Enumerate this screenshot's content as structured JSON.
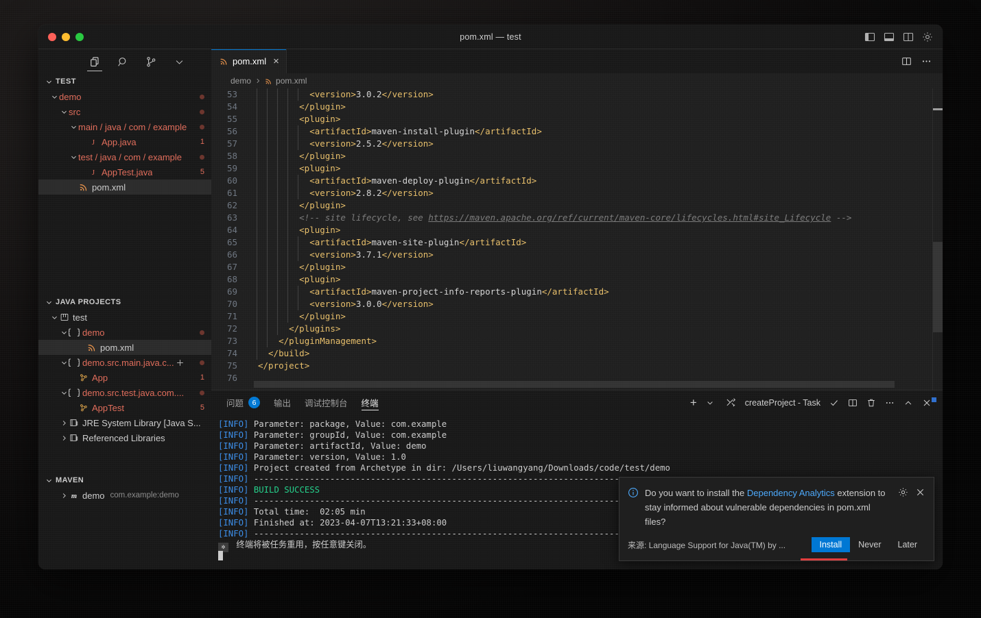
{
  "window": {
    "title": "pom.xml — test",
    "traffic_lights": [
      "close",
      "minimize",
      "zoom"
    ],
    "layout_icons": [
      "toggle-primary-sidebar",
      "toggle-panel",
      "toggle-secondary-sidebar",
      "customize-layout"
    ]
  },
  "activitybar": {
    "items": [
      {
        "name": "explorer",
        "icon": "files-icon",
        "active": true
      },
      {
        "name": "search",
        "icon": "search-icon",
        "active": false
      },
      {
        "name": "source-control",
        "icon": "source-control-icon",
        "active": false
      },
      {
        "name": "more",
        "icon": "chevron-down-icon",
        "active": false
      }
    ]
  },
  "sidebar": {
    "explorer": {
      "title": "TEST",
      "rows": [
        {
          "label": "demo",
          "indent": 16,
          "twisty": "down",
          "modified": true,
          "marker": "dot",
          "icon": "",
          "cls": "mod"
        },
        {
          "label": "src",
          "indent": 30,
          "twisty": "down",
          "modified": true,
          "marker": "dot",
          "icon": "",
          "cls": "mod"
        },
        {
          "label": "main / java / com / example",
          "indent": 44,
          "twisty": "down",
          "modified": true,
          "marker": "dot",
          "icon": "",
          "cls": "mod"
        },
        {
          "label": "App.java",
          "indent": 72,
          "twisty": "none",
          "marker": "count",
          "count": "1",
          "icon": "java-icon",
          "cls": "mod"
        },
        {
          "label": "test / java / com / example",
          "indent": 44,
          "twisty": "down",
          "modified": true,
          "marker": "dot",
          "icon": "",
          "cls": "mod"
        },
        {
          "label": "AppTest.java",
          "indent": 72,
          "twisty": "none",
          "marker": "count",
          "count": "5",
          "icon": "java-icon",
          "cls": "mod"
        },
        {
          "label": "pom.xml",
          "indent": 58,
          "twisty": "none",
          "marker": "none",
          "icon": "xml-icon",
          "cls": "",
          "selected": true
        }
      ]
    },
    "java_projects": {
      "title": "JAVA PROJECTS",
      "rows": [
        {
          "label": "test",
          "indent": 16,
          "twisty": "down",
          "icon": "project-icon",
          "marker": "none",
          "cls": ""
        },
        {
          "label": "demo",
          "indent": 30,
          "twisty": "down",
          "icon": "package-icon",
          "marker": "dot",
          "cls": "mod"
        },
        {
          "label": "pom.xml",
          "indent": 70,
          "twisty": "none",
          "icon": "xml-icon",
          "marker": "none",
          "cls": "",
          "selected": true
        },
        {
          "label": "demo.src.main.java.c...",
          "indent": 30,
          "twisty": "down",
          "icon": "package-icon",
          "marker": "dot",
          "cls": "mod",
          "plus": true
        },
        {
          "label": "App",
          "indent": 58,
          "twisty": "none",
          "icon": "class-icon",
          "marker": "count",
          "count": "1",
          "cls": "mod"
        },
        {
          "label": "demo.src.test.java.com....",
          "indent": 30,
          "twisty": "down",
          "icon": "package-icon",
          "marker": "dot",
          "cls": "mod"
        },
        {
          "label": "AppTest",
          "indent": 58,
          "twisty": "none",
          "icon": "class-icon",
          "marker": "count",
          "count": "5",
          "cls": "mod"
        },
        {
          "label": "JRE System Library [Java S...",
          "indent": 30,
          "twisty": "right",
          "icon": "library-icon",
          "marker": "none",
          "cls": ""
        },
        {
          "label": "Referenced Libraries",
          "indent": 30,
          "twisty": "right",
          "icon": "library-icon",
          "marker": "none",
          "cls": ""
        }
      ]
    },
    "maven": {
      "title": "MAVEN",
      "rows": [
        {
          "label": "demo",
          "sub": "com.example:demo",
          "indent": 30,
          "twisty": "right",
          "icon": "maven-icon"
        }
      ]
    }
  },
  "editor": {
    "tab": {
      "label": "pom.xml",
      "icon": "xml-icon",
      "close": "×"
    },
    "tab_actions": [
      "split-editor-icon",
      "more-actions-icon"
    ],
    "breadcrumb": [
      "demo",
      "pom.xml"
    ],
    "first_line_number": 53,
    "lines": [
      {
        "n": 53,
        "indent": 10,
        "html": "<span class='t'>&lt;version&gt;</span><span class='txt'>3.0.2</span><span class='t'>&lt;/version&gt;</span>"
      },
      {
        "n": 54,
        "indent": 8,
        "html": "<span class='t'>&lt;/plugin&gt;</span>"
      },
      {
        "n": 55,
        "indent": 8,
        "html": "<span class='t'>&lt;plugin&gt;</span>"
      },
      {
        "n": 56,
        "indent": 10,
        "html": "<span class='t'>&lt;artifactId&gt;</span><span class='txt'>maven-install-plugin</span><span class='t'>&lt;/artifactId&gt;</span>"
      },
      {
        "n": 57,
        "indent": 10,
        "html": "<span class='t'>&lt;version&gt;</span><span class='txt'>2.5.2</span><span class='t'>&lt;/version&gt;</span>"
      },
      {
        "n": 58,
        "indent": 8,
        "html": "<span class='t'>&lt;/plugin&gt;</span>"
      },
      {
        "n": 59,
        "indent": 8,
        "html": "<span class='t'>&lt;plugin&gt;</span>"
      },
      {
        "n": 60,
        "indent": 10,
        "html": "<span class='t'>&lt;artifactId&gt;</span><span class='txt'>maven-deploy-plugin</span><span class='t'>&lt;/artifactId&gt;</span>"
      },
      {
        "n": 61,
        "indent": 10,
        "html": "<span class='t'>&lt;version&gt;</span><span class='txt'>2.8.2</span><span class='t'>&lt;/version&gt;</span>"
      },
      {
        "n": 62,
        "indent": 8,
        "html": "<span class='t'>&lt;/plugin&gt;</span>"
      },
      {
        "n": 63,
        "indent": 8,
        "html": "<span class='cm'>&lt;!-- site lifecycle, see </span><span class='lnk'>https://maven.apache.org/ref/current/maven-core/lifecycles.html#site_Lifecycle</span><span class='cm'> --&gt;</span>"
      },
      {
        "n": 64,
        "indent": 8,
        "html": "<span class='t'>&lt;plugin&gt;</span>"
      },
      {
        "n": 65,
        "indent": 10,
        "html": "<span class='t'>&lt;artifactId&gt;</span><span class='txt'>maven-site-plugin</span><span class='t'>&lt;/artifactId&gt;</span>"
      },
      {
        "n": 66,
        "indent": 10,
        "html": "<span class='t'>&lt;version&gt;</span><span class='txt'>3.7.1</span><span class='t'>&lt;/version&gt;</span>"
      },
      {
        "n": 67,
        "indent": 8,
        "html": "<span class='t'>&lt;/plugin&gt;</span>"
      },
      {
        "n": 68,
        "indent": 8,
        "html": "<span class='t'>&lt;plugin&gt;</span>"
      },
      {
        "n": 69,
        "indent": 10,
        "html": "<span class='t'>&lt;artifactId&gt;</span><span class='txt'>maven-project-info-reports-plugin</span><span class='t'>&lt;/artifactId&gt;</span>"
      },
      {
        "n": 70,
        "indent": 10,
        "html": "<span class='t'>&lt;version&gt;</span><span class='txt'>3.0.0</span><span class='t'>&lt;/version&gt;</span>"
      },
      {
        "n": 71,
        "indent": 8,
        "html": "<span class='t'>&lt;/plugin&gt;</span>"
      },
      {
        "n": 72,
        "indent": 6,
        "html": "<span class='t'>&lt;/plugins&gt;</span>"
      },
      {
        "n": 73,
        "indent": 4,
        "html": "<span class='t'>&lt;/pluginManagement&gt;</span>"
      },
      {
        "n": 74,
        "indent": 2,
        "html": "<span class='t'>&lt;/build&gt;</span>"
      },
      {
        "n": 75,
        "indent": 0,
        "html": "<span class='t'>&lt;/project&gt;</span>"
      },
      {
        "n": 76,
        "indent": 0,
        "html": ""
      }
    ]
  },
  "panel": {
    "tabs": [
      {
        "label": "问题",
        "badge": "6",
        "active": false
      },
      {
        "label": "输出",
        "badge": "",
        "active": false
      },
      {
        "label": "调试控制台",
        "badge": "",
        "active": false
      },
      {
        "label": "终端",
        "badge": "",
        "active": true
      }
    ],
    "actions": {
      "new_terminal": "+",
      "new_terminal_dropdown": "chevron-down-icon",
      "task_icon": "tools-icon",
      "terminal_name": "createProject - Task",
      "check": "check-icon",
      "split": "split-terminal-icon",
      "kill": "trash-icon",
      "more": "more-actions-icon",
      "maximize": "chevron-up-icon",
      "close": "close-icon"
    },
    "terminal_lines": [
      {
        "html": "<span class='info'>[INFO]</span> Parameter: package, Value: com.example"
      },
      {
        "html": "<span class='info'>[INFO]</span> Parameter: groupId, Value: com.example"
      },
      {
        "html": "<span class='info'>[INFO]</span> Parameter: artifactId, Value: demo"
      },
      {
        "html": "<span class='info'>[INFO]</span> Parameter: version, Value: 1.0"
      },
      {
        "html": "<span class='info'>[INFO]</span> Project created from Archetype in dir: /Users/liuwangyang/Downloads/code/test/demo"
      },
      {
        "html": "<span class='info'>[INFO]</span> ------------------------------------------------------------------------"
      },
      {
        "html": "<span class='info'>[INFO]</span> <span class='ok'>BUILD SUCCESS</span>"
      },
      {
        "html": "<span class='info'>[INFO]</span> ------------------------------------------------------------------------"
      },
      {
        "html": "<span class='info'>[INFO]</span> Total time:  02:05 min"
      },
      {
        "html": "<span class='info'>[INFO]</span> Finished at: 2023-04-07T13:21:33+08:00"
      },
      {
        "html": "<span class='info'>[INFO]</span> ------------------------------------------------------------------------"
      },
      {
        "html": "<span class='star-box'>✲</span> 终端将被任务重用，按任意键关闭。"
      },
      {
        "html": "<span class='caret'></span>"
      }
    ]
  },
  "notification": {
    "icon": "info-icon",
    "message_part1": "Do you want to install the ",
    "message_link": "Dependency Analytics",
    "message_part2": " extension to stay informed about vulnerable dependencies in pom.xml files?",
    "gear": "gear-icon",
    "close": "close-icon",
    "source": "来源: Language Support for Java(TM) by ...",
    "buttons": [
      {
        "label": "Install",
        "primary": true
      },
      {
        "label": "Never",
        "primary": false
      },
      {
        "label": "Later",
        "primary": false
      }
    ]
  },
  "colors": {
    "accent": "#0078d4",
    "modified": "#e06c5a",
    "success": "#23d18b",
    "info": "#3b8eea",
    "xml_tag": "#e8bf6a",
    "link": "#4daafc",
    "red_underline": "#e13d3d"
  }
}
